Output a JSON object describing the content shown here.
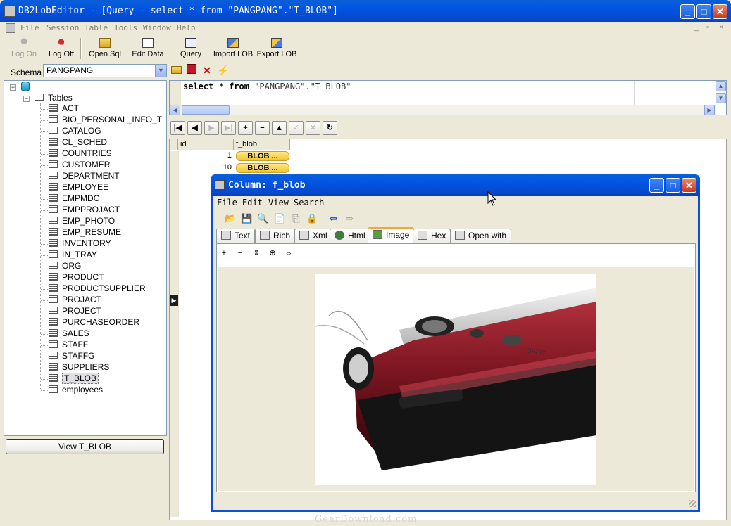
{
  "window": {
    "title": "DB2LobEditor - [Query - select * from \"PANGPANG\".\"T_BLOB\"]",
    "min_label": "_",
    "max_label": "□",
    "close_label": "✕"
  },
  "menu": {
    "items": [
      "File",
      "Session",
      "Table",
      "Tools",
      "Window",
      "Help"
    ],
    "mdi_controls": [
      "_",
      "▫",
      "×"
    ]
  },
  "toolbar": {
    "buttons": [
      {
        "label": "Log On",
        "enabled": false,
        "icon": "log-on-icon"
      },
      {
        "label": "Log Off",
        "enabled": true,
        "icon": "log-off-icon"
      },
      {
        "label": "Open Sql",
        "enabled": true,
        "icon": "folder-icon"
      },
      {
        "label": "Edit Data",
        "enabled": true,
        "icon": "edit-data-icon"
      },
      {
        "label": "Query",
        "enabled": true,
        "icon": "query-icon"
      },
      {
        "label": "Import LOB",
        "enabled": true,
        "icon": "import-icon"
      },
      {
        "label": "Export LOB",
        "enabled": true,
        "icon": "export-icon"
      }
    ]
  },
  "schema": {
    "label": "Schema",
    "value": "PANGPANG"
  },
  "tree": {
    "root_label": "Tables",
    "tables": [
      "ACT",
      "BIO_PERSONAL_INFO_T",
      "CATALOG",
      "CL_SCHED",
      "COUNTRIES",
      "CUSTOMER",
      "DEPARTMENT",
      "EMPLOYEE",
      "EMPMDC",
      "EMPPROJACT",
      "EMP_PHOTO",
      "EMP_RESUME",
      "INVENTORY",
      "IN_TRAY",
      "ORG",
      "PRODUCT",
      "PRODUCTSUPPLIER",
      "PROJACT",
      "PROJECT",
      "PURCHASEORDER",
      "SALES",
      "STAFF",
      "STAFFG",
      "SUPPLIERS",
      "T_BLOB",
      "employees"
    ],
    "selected": "T_BLOB",
    "expand_minus": "−"
  },
  "view_button": "View T_BLOB",
  "sql": {
    "kw_select": "select",
    "star": "*",
    "kw_from": "from",
    "target": "\"PANGPANG\".\"T_BLOB\""
  },
  "grid": {
    "columns": [
      "id",
      "f_blob"
    ],
    "rows": [
      {
        "id": "1",
        "f_blob": "BLOB ..."
      },
      {
        "id": "10",
        "f_blob": "BLOB ..."
      }
    ]
  },
  "navigator": [
    "|◀",
    "◀",
    "▶",
    "▶|",
    "+",
    "−",
    "▲",
    "✓",
    "✕",
    "↻"
  ],
  "column_window": {
    "title": "Column: f_blob",
    "menu": [
      "File",
      "Edit",
      "View",
      "Search"
    ],
    "tabs": [
      "Text",
      "Rich",
      "Xml",
      "Html",
      "Image",
      "Hex",
      "Open with"
    ],
    "active_tab": "Image",
    "tool_glyphs": [
      "📂",
      "💾",
      "🔍",
      "📄",
      "⎘",
      "🔒",
      "⇦",
      "⇨"
    ],
    "zoom_glyphs": [
      "+",
      "−",
      "⇕",
      "⊕",
      "⇔"
    ]
  },
  "photo_caption": "ORBIT",
  "watermark": "GearDownload.com",
  "colors": {
    "titlebar": "#0054e3",
    "blob_button": "#f3c52b",
    "active_tab_accent": "#f7a636"
  }
}
